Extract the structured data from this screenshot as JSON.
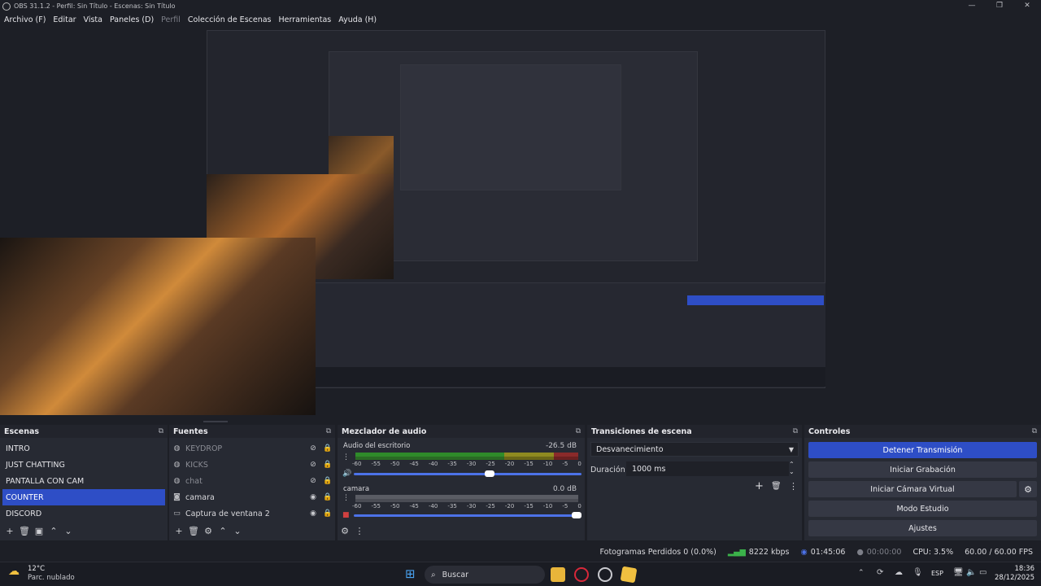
{
  "window": {
    "title": "OBS 31.1.2 - Perfil: Sin Título - Escenas: Sin Título"
  },
  "menu": [
    "Archivo (F)",
    "Editar",
    "Vista",
    "Paneles (D)",
    "Perfil",
    "Colección de Escenas",
    "Herramientas",
    "Ayuda (H)"
  ],
  "scenes": {
    "title": "Escenas",
    "items": [
      "INTRO",
      "JUST CHATTING",
      "PANTALLA CON CAM",
      "COUNTER",
      "DISCORD"
    ],
    "selected": "COUNTER"
  },
  "sources": {
    "title": "Fuentes",
    "items": [
      {
        "label": "KEYDROP",
        "icon": "browser-icon",
        "visible": false
      },
      {
        "label": "KICKS",
        "icon": "browser-icon",
        "visible": false
      },
      {
        "label": "chat",
        "icon": "browser-icon",
        "visible": false
      },
      {
        "label": "camara",
        "icon": "camera-icon",
        "visible": true
      },
      {
        "label": "Captura de ventana 2",
        "icon": "window-capture-icon",
        "visible": true
      }
    ]
  },
  "mixer": {
    "title": "Mezclador de audio",
    "ticks": [
      "-60",
      "-55",
      "-50",
      "-45",
      "-40",
      "-35",
      "-30",
      "-25",
      "-20",
      "-15",
      "-10",
      "-5",
      "0"
    ],
    "channels": [
      {
        "name": "Audio del escritorio",
        "db": "-26.5 dB",
        "level": 0.6,
        "muted": false
      },
      {
        "name": "camara",
        "db": "0.0 dB",
        "level": 1.0,
        "muted": true
      }
    ]
  },
  "transitions": {
    "title": "Transiciones de escena",
    "selected": "Desvanecimiento",
    "duration_label": "Duración",
    "duration_value": "1000 ms"
  },
  "controls": {
    "title": "Controles",
    "buttons": [
      "Detener Transmisión",
      "Iniciar Grabación",
      "Iniciar Cámara Virtual",
      "Modo Estudio",
      "Ajustes"
    ]
  },
  "status": {
    "dropped": "Fotogramas Perdidos 0 (0.0%)",
    "bitrate": "8222 kbps",
    "stream_time": "01:45:06",
    "rec_time": "00:00:00",
    "cpu": "CPU: 3.5%",
    "fps": "60.00 / 60.00 FPS"
  },
  "taskbar": {
    "weather_temp": "12°C",
    "weather_desc": "Parc. nublado",
    "search_placeholder": "Buscar",
    "lang": "ESP",
    "time": "18:36",
    "date": "28/12/2025"
  },
  "colors": {
    "accent": "#2e4ec6",
    "background": "#1d1f26",
    "panel": "#272a33"
  }
}
